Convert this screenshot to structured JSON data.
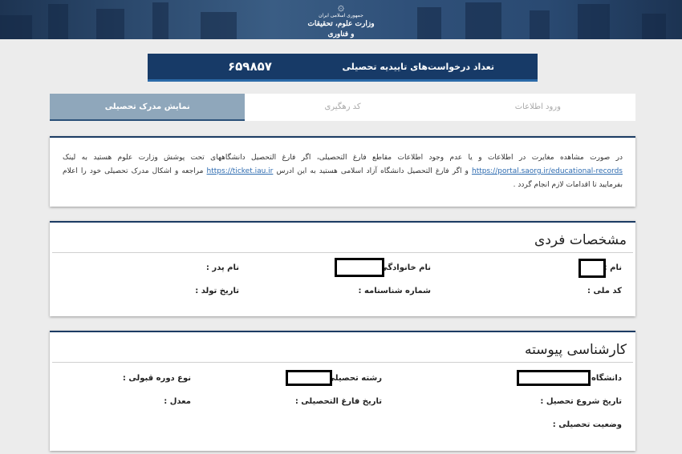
{
  "header": {
    "logo_line1": "جمهوری اسلامی ایران",
    "logo_line2": "وزارت علوم، تحقیقات و فناوری",
    "logo_icon": "iran-emblem-icon"
  },
  "counter": {
    "label": "تعداد درخواست‌های تاییدیه تحصیلی",
    "value": "۶۵۹۸۵۷"
  },
  "tabs": [
    {
      "label": "ورود اطلاعات",
      "active": false
    },
    {
      "label": "کد رهگیری",
      "active": false
    },
    {
      "label": "نمایش مدرک تحصیلی",
      "active": true
    }
  ],
  "notice": {
    "text1": "در صورت مشاهده مغایرت در اطلاعات و یا عدم وجود اطلاعات مقاطع فارغ التحصیلی، اگر فارغ التحصیل دانشگاههای تحت پوشش وزارت علوم هستید به لینک",
    "link1": "https://portal.saorg.ir/educational-records",
    "text2": " و اگر فارغ التحصیل دانشگاه آزاد اسلامی هستید به این ادرس ",
    "link2": "https://ticket.iau.ir",
    "text3": " مراجعه و اشکال مدرک تحصیلی خود را اعلام بفرمایید تا اقدامات لازم انجام گردد ."
  },
  "personal": {
    "title": "مشخصات فردی",
    "first_name_label": "نام :",
    "last_name_label": "نام خانوادگی :",
    "father_name_label": "نام پدر :",
    "national_id_label": "کد ملی :",
    "id_number_label": "شماره شناسنامه :",
    "birth_date_label": "تاریخ تولد :"
  },
  "degree": {
    "title": "کارشناسی پیوسته",
    "university_label": "دانشگاه :",
    "major_label": "رشته تحصیلی :",
    "course_type_label": "نوع دوره قبولی :",
    "start_date_label": "تاریخ شروع تحصیل :",
    "graduation_date_label": "تاریخ فارغ التحصیلی :",
    "gpa_label": "معدل :",
    "status_label": "وضعیت تحصیلی :"
  },
  "colors": {
    "header_bg": "#1d3452",
    "counter_bg": "#173a67",
    "active_tab_bg": "#8fa7bb",
    "link": "#2d6bb0"
  }
}
